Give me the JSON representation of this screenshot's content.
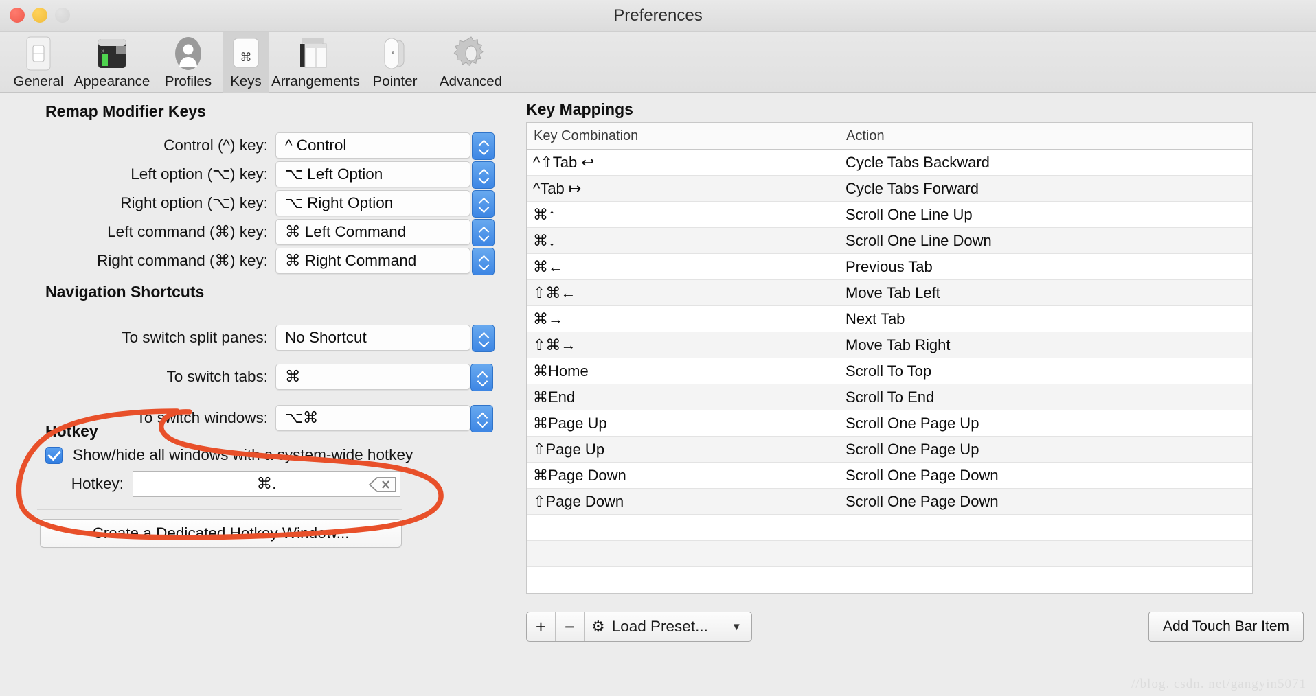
{
  "window": {
    "title": "Preferences",
    "traffic_lights": [
      "close-red",
      "minimize-yellow",
      "zoom-gray"
    ]
  },
  "toolbar": {
    "items": [
      {
        "label": "General",
        "icon": "general-icon",
        "selected": false
      },
      {
        "label": "Appearance",
        "icon": "appearance-icon",
        "selected": false
      },
      {
        "label": "Profiles",
        "icon": "profiles-icon",
        "selected": false
      },
      {
        "label": "Keys",
        "icon": "keys-icon",
        "selected": true
      },
      {
        "label": "Arrangements",
        "icon": "arrangements-icon",
        "selected": false
      },
      {
        "label": "Pointer",
        "icon": "pointer-icon",
        "selected": false
      },
      {
        "label": "Advanced",
        "icon": "advanced-icon",
        "selected": false
      }
    ]
  },
  "remap": {
    "heading": "Remap Modifier Keys",
    "rows": [
      {
        "label": "Control (^) key:",
        "value": "^ Control"
      },
      {
        "label": "Left option (⌥) key:",
        "value": "⌥ Left Option"
      },
      {
        "label": "Right option (⌥) key:",
        "value": "⌥ Right Option"
      },
      {
        "label": "Left command (⌘) key:",
        "value": "⌘ Left Command"
      },
      {
        "label": "Right command (⌘) key:",
        "value": "⌘ Right Command"
      }
    ]
  },
  "navigation": {
    "heading": "Navigation Shortcuts",
    "rows": [
      {
        "label": "To switch split panes:",
        "value": "No Shortcut"
      },
      {
        "label": "To switch tabs:",
        "value": "⌘"
      },
      {
        "label": "To switch windows:",
        "value": "⌥⌘"
      }
    ]
  },
  "hotkey": {
    "heading": "Hotkey",
    "checkbox_label": "Show/hide all windows with a system-wide hotkey",
    "checkbox_checked": true,
    "field_label": "Hotkey:",
    "field_value": "⌘.",
    "clear_icon": "delete-key-icon",
    "button_label": "Create a Dedicated Hotkey Window..."
  },
  "key_mappings": {
    "heading": "Key Mappings",
    "columns": [
      "Key Combination",
      "Action"
    ],
    "rows": [
      {
        "combo": "^⇧Tab ↩",
        "action": "Cycle Tabs Backward"
      },
      {
        "combo": "^Tab ↦",
        "action": "Cycle Tabs Forward"
      },
      {
        "combo": "⌘↑",
        "action": "Scroll One Line Up"
      },
      {
        "combo": "⌘↓",
        "action": "Scroll One Line Down"
      },
      {
        "combo": "⌘←",
        "action": "Previous Tab"
      },
      {
        "combo": "⇧⌘←",
        "action": "Move Tab Left"
      },
      {
        "combo": "⌘→",
        "action": "Next Tab"
      },
      {
        "combo": "⇧⌘→",
        "action": "Move Tab Right"
      },
      {
        "combo": "⌘Home",
        "action": "Scroll To Top"
      },
      {
        "combo": "⌘End",
        "action": "Scroll To End"
      },
      {
        "combo": "⌘Page Up",
        "action": "Scroll One Page Up"
      },
      {
        "combo": "⇧Page Up",
        "action": "Scroll One Page Up"
      },
      {
        "combo": "⌘Page Down",
        "action": "Scroll One Page Down"
      },
      {
        "combo": "⇧Page Down",
        "action": "Scroll One Page Down"
      },
      {
        "combo": "",
        "action": ""
      },
      {
        "combo": "",
        "action": ""
      },
      {
        "combo": "",
        "action": ""
      }
    ]
  },
  "bottom_bar": {
    "add_label": "+",
    "remove_label": "−",
    "preset_label": "Load Preset...",
    "preset_icon": "gear-icon",
    "caret_icon": "chevron-down-icon",
    "touch_bar_label": "Add Touch Bar Item"
  },
  "watermark": "//blog. csdn. net/gangyin5071",
  "annotation": {
    "type": "hand-drawn-circle",
    "color": "#e8502a",
    "target": "Hotkey"
  },
  "colors": {
    "accent_blue": "#3d86e4",
    "checkbox_blue": "#2f7ce0",
    "annotation_red": "#e8502a",
    "window_bg": "#ececec"
  }
}
